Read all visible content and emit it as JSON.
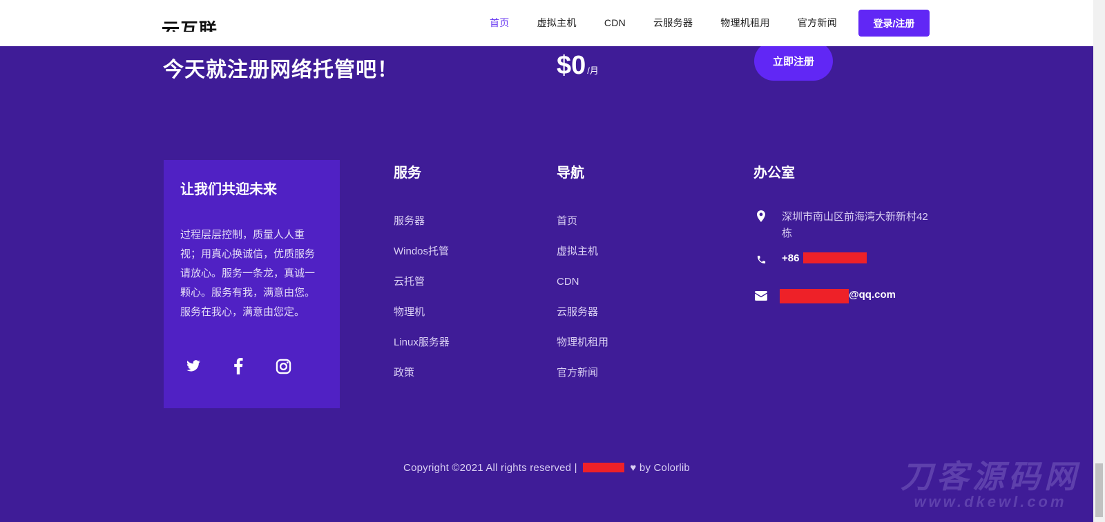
{
  "header": {
    "logo_text": "云互联",
    "nav": [
      "首页",
      "虚拟主机",
      "CDN",
      "云服务器",
      "物理机租用",
      "官方新闻"
    ],
    "login_label": "登录/注册"
  },
  "cta": {
    "title": "今天就注册网络托管吧！",
    "price_amount": "$0",
    "price_unit": "/月",
    "button_label": "立即注册"
  },
  "footer": {
    "about": {
      "title": "让我们共迎未来",
      "text": "过程层层控制，质量人人重视；用真心换诚信，优质服务请放心。服务一条龙，真诚一颗心。服务有我，满意由您。服务在我心，满意由您定。",
      "socials": [
        "twitter-icon",
        "facebook-icon",
        "instagram-icon"
      ]
    },
    "services": {
      "title": "服务",
      "items": [
        "服务器",
        "Windos托管",
        "云托管",
        "物理机",
        "Linux服务器",
        "政策"
      ]
    },
    "navigation": {
      "title": "导航",
      "items": [
        "首页",
        "虚拟主机",
        "CDN",
        "云服务器",
        "物理机租用",
        "官方新闻"
      ]
    },
    "office": {
      "title": "办公室",
      "address": "深圳市南山区前海湾大新新村42栋",
      "phone_prefix": "+86",
      "email_suffix": "@qq.com"
    },
    "copyright_prefix": "Copyright ©2021 All rights reserved |",
    "copyright_suffix": "by Colorlib"
  },
  "watermark": {
    "line1": "刀客源码网",
    "line2": "www.dkewl.com"
  },
  "colors": {
    "background": "#3f1c97",
    "about_box": "#5021c4",
    "accent": "#6127f5",
    "nav_active": "#6b3cf2",
    "redaction": "#ee2128"
  }
}
